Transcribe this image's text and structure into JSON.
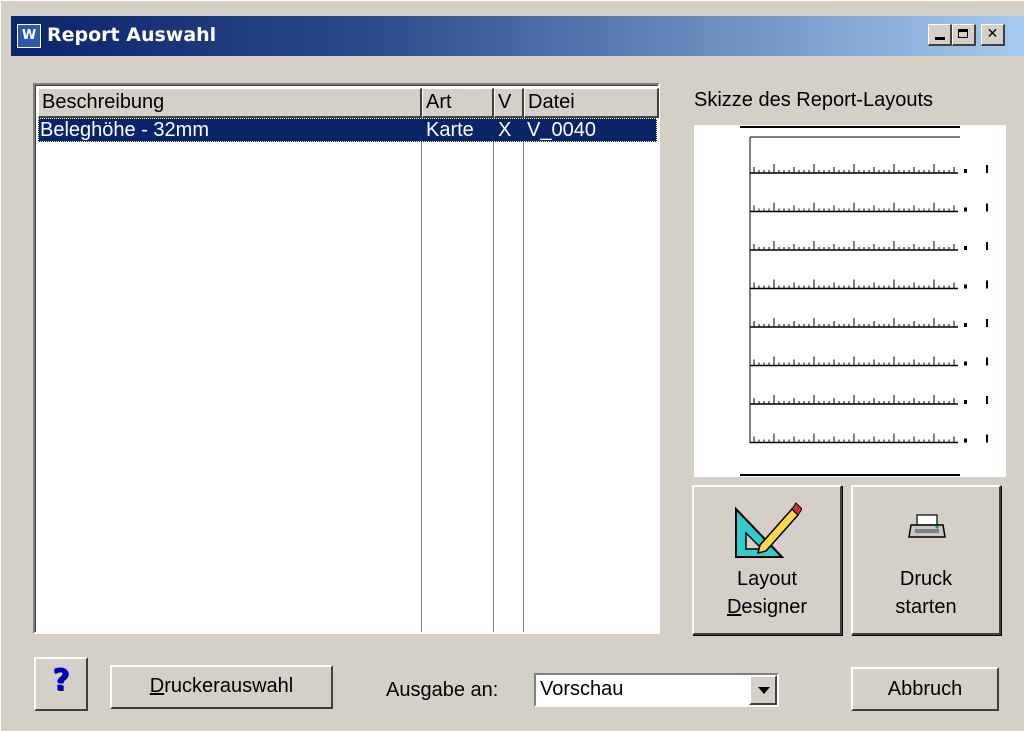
{
  "window": {
    "title": "Report Auswahl",
    "app_icon": "app-logo-icon"
  },
  "list": {
    "columns": [
      "Beschreibung",
      "Art",
      "V",
      "Datei"
    ],
    "rows": [
      {
        "beschreibung": "Beleghöhe - 32mm",
        "art": "Karte",
        "v": "X",
        "datei": "V_0040",
        "selected": true
      }
    ]
  },
  "sketch": {
    "label": "Skizze des Report-Layouts",
    "lines": 8
  },
  "buttons": {
    "layout_designer": {
      "line1": "Layout",
      "line2_accel": "D",
      "line2_rest": "esigner",
      "icon": "triangle-ruler-pencil-icon"
    },
    "druck_starten": {
      "line1": "Druck",
      "line2": "starten",
      "icon": "printer-icon"
    },
    "help": {
      "label": "?",
      "icon": "help-icon"
    },
    "druckerauswahl": {
      "accel": "D",
      "rest": "ruckerauswahl"
    },
    "abbruch": {
      "label": "Abbruch"
    }
  },
  "ausgabe": {
    "label": "Ausgabe an:",
    "value": "Vorschau"
  },
  "colors": {
    "title_start": "#0a246a",
    "title_end": "#a6caf0",
    "selection": "#0a246a",
    "face": "#d4d0c8"
  }
}
